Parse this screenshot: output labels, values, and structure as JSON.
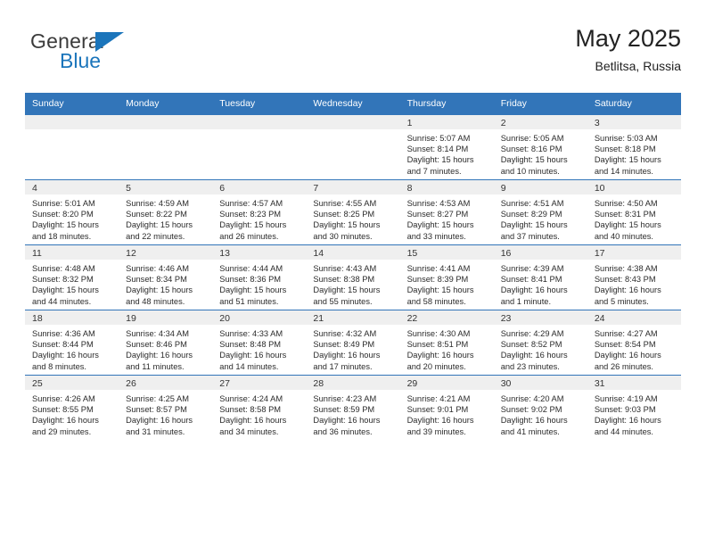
{
  "brand": {
    "name_top": "General",
    "name_bottom": "Blue",
    "flag_icon": "triangle-flag-icon",
    "accent_color": "#1b75bb"
  },
  "header": {
    "title": "May 2025",
    "subtitle": "Betlitsa, Russia"
  },
  "calendar": {
    "header_bg": "#3275b9",
    "daynum_bg": "#efefef",
    "weekday_headers": [
      "Sunday",
      "Monday",
      "Tuesday",
      "Wednesday",
      "Thursday",
      "Friday",
      "Saturday"
    ],
    "weeks": [
      [
        {
          "day": "",
          "lines": []
        },
        {
          "day": "",
          "lines": []
        },
        {
          "day": "",
          "lines": []
        },
        {
          "day": "",
          "lines": []
        },
        {
          "day": "1",
          "lines": [
            "Sunrise: 5:07 AM",
            "Sunset: 8:14 PM",
            "Daylight: 15 hours",
            "and 7 minutes."
          ]
        },
        {
          "day": "2",
          "lines": [
            "Sunrise: 5:05 AM",
            "Sunset: 8:16 PM",
            "Daylight: 15 hours",
            "and 10 minutes."
          ]
        },
        {
          "day": "3",
          "lines": [
            "Sunrise: 5:03 AM",
            "Sunset: 8:18 PM",
            "Daylight: 15 hours",
            "and 14 minutes."
          ]
        }
      ],
      [
        {
          "day": "4",
          "lines": [
            "Sunrise: 5:01 AM",
            "Sunset: 8:20 PM",
            "Daylight: 15 hours",
            "and 18 minutes."
          ]
        },
        {
          "day": "5",
          "lines": [
            "Sunrise: 4:59 AM",
            "Sunset: 8:22 PM",
            "Daylight: 15 hours",
            "and 22 minutes."
          ]
        },
        {
          "day": "6",
          "lines": [
            "Sunrise: 4:57 AM",
            "Sunset: 8:23 PM",
            "Daylight: 15 hours",
            "and 26 minutes."
          ]
        },
        {
          "day": "7",
          "lines": [
            "Sunrise: 4:55 AM",
            "Sunset: 8:25 PM",
            "Daylight: 15 hours",
            "and 30 minutes."
          ]
        },
        {
          "day": "8",
          "lines": [
            "Sunrise: 4:53 AM",
            "Sunset: 8:27 PM",
            "Daylight: 15 hours",
            "and 33 minutes."
          ]
        },
        {
          "day": "9",
          "lines": [
            "Sunrise: 4:51 AM",
            "Sunset: 8:29 PM",
            "Daylight: 15 hours",
            "and 37 minutes."
          ]
        },
        {
          "day": "10",
          "lines": [
            "Sunrise: 4:50 AM",
            "Sunset: 8:31 PM",
            "Daylight: 15 hours",
            "and 40 minutes."
          ]
        }
      ],
      [
        {
          "day": "11",
          "lines": [
            "Sunrise: 4:48 AM",
            "Sunset: 8:32 PM",
            "Daylight: 15 hours",
            "and 44 minutes."
          ]
        },
        {
          "day": "12",
          "lines": [
            "Sunrise: 4:46 AM",
            "Sunset: 8:34 PM",
            "Daylight: 15 hours",
            "and 48 minutes."
          ]
        },
        {
          "day": "13",
          "lines": [
            "Sunrise: 4:44 AM",
            "Sunset: 8:36 PM",
            "Daylight: 15 hours",
            "and 51 minutes."
          ]
        },
        {
          "day": "14",
          "lines": [
            "Sunrise: 4:43 AM",
            "Sunset: 8:38 PM",
            "Daylight: 15 hours",
            "and 55 minutes."
          ]
        },
        {
          "day": "15",
          "lines": [
            "Sunrise: 4:41 AM",
            "Sunset: 8:39 PM",
            "Daylight: 15 hours",
            "and 58 minutes."
          ]
        },
        {
          "day": "16",
          "lines": [
            "Sunrise: 4:39 AM",
            "Sunset: 8:41 PM",
            "Daylight: 16 hours",
            "and 1 minute."
          ]
        },
        {
          "day": "17",
          "lines": [
            "Sunrise: 4:38 AM",
            "Sunset: 8:43 PM",
            "Daylight: 16 hours",
            "and 5 minutes."
          ]
        }
      ],
      [
        {
          "day": "18",
          "lines": [
            "Sunrise: 4:36 AM",
            "Sunset: 8:44 PM",
            "Daylight: 16 hours",
            "and 8 minutes."
          ]
        },
        {
          "day": "19",
          "lines": [
            "Sunrise: 4:34 AM",
            "Sunset: 8:46 PM",
            "Daylight: 16 hours",
            "and 11 minutes."
          ]
        },
        {
          "day": "20",
          "lines": [
            "Sunrise: 4:33 AM",
            "Sunset: 8:48 PM",
            "Daylight: 16 hours",
            "and 14 minutes."
          ]
        },
        {
          "day": "21",
          "lines": [
            "Sunrise: 4:32 AM",
            "Sunset: 8:49 PM",
            "Daylight: 16 hours",
            "and 17 minutes."
          ]
        },
        {
          "day": "22",
          "lines": [
            "Sunrise: 4:30 AM",
            "Sunset: 8:51 PM",
            "Daylight: 16 hours",
            "and 20 minutes."
          ]
        },
        {
          "day": "23",
          "lines": [
            "Sunrise: 4:29 AM",
            "Sunset: 8:52 PM",
            "Daylight: 16 hours",
            "and 23 minutes."
          ]
        },
        {
          "day": "24",
          "lines": [
            "Sunrise: 4:27 AM",
            "Sunset: 8:54 PM",
            "Daylight: 16 hours",
            "and 26 minutes."
          ]
        }
      ],
      [
        {
          "day": "25",
          "lines": [
            "Sunrise: 4:26 AM",
            "Sunset: 8:55 PM",
            "Daylight: 16 hours",
            "and 29 minutes."
          ]
        },
        {
          "day": "26",
          "lines": [
            "Sunrise: 4:25 AM",
            "Sunset: 8:57 PM",
            "Daylight: 16 hours",
            "and 31 minutes."
          ]
        },
        {
          "day": "27",
          "lines": [
            "Sunrise: 4:24 AM",
            "Sunset: 8:58 PM",
            "Daylight: 16 hours",
            "and 34 minutes."
          ]
        },
        {
          "day": "28",
          "lines": [
            "Sunrise: 4:23 AM",
            "Sunset: 8:59 PM",
            "Daylight: 16 hours",
            "and 36 minutes."
          ]
        },
        {
          "day": "29",
          "lines": [
            "Sunrise: 4:21 AM",
            "Sunset: 9:01 PM",
            "Daylight: 16 hours",
            "and 39 minutes."
          ]
        },
        {
          "day": "30",
          "lines": [
            "Sunrise: 4:20 AM",
            "Sunset: 9:02 PM",
            "Daylight: 16 hours",
            "and 41 minutes."
          ]
        },
        {
          "day": "31",
          "lines": [
            "Sunrise: 4:19 AM",
            "Sunset: 9:03 PM",
            "Daylight: 16 hours",
            "and 44 minutes."
          ]
        }
      ]
    ]
  }
}
